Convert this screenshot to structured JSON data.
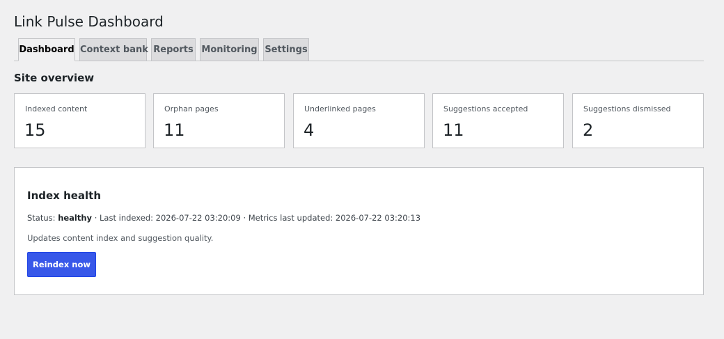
{
  "page": {
    "title": "Link Pulse Dashboard"
  },
  "tabs": [
    {
      "label": "Dashboard",
      "active": true
    },
    {
      "label": "Context bank",
      "active": false
    },
    {
      "label": "Reports",
      "active": false
    },
    {
      "label": "Monitoring",
      "active": false
    },
    {
      "label": "Settings",
      "active": false
    }
  ],
  "overview": {
    "title": "Site overview",
    "stats": [
      {
        "label": "Indexed content",
        "value": "15"
      },
      {
        "label": "Orphan pages",
        "value": "11"
      },
      {
        "label": "Underlinked pages",
        "value": "4"
      },
      {
        "label": "Suggestions accepted",
        "value": "11"
      },
      {
        "label": "Suggestions dismissed",
        "value": "2"
      }
    ]
  },
  "index_health": {
    "title": "Index health",
    "status_prefix": "Status: ",
    "status_value": "healthy",
    "status_suffix": " · Last indexed: 2026-07-22 03:20:09 · Metrics last updated: 2026-07-22 03:20:13",
    "description": "Updates content index and suggestion quality.",
    "reindex_button": "Reindex now"
  },
  "colors": {
    "page_background": "#f0f0f1",
    "primary_button": "#3858e9",
    "border": "#c3c4c7"
  }
}
